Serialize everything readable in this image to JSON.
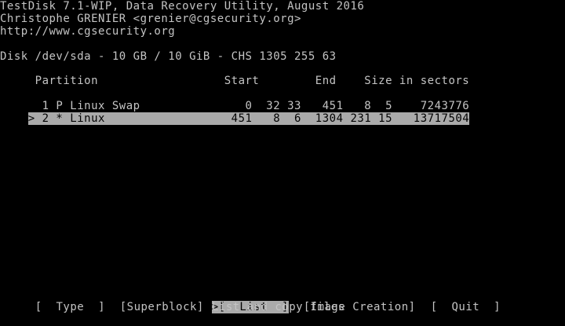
{
  "header": {
    "title": "TestDisk 7.1-WIP, Data Recovery Utility, August 2016",
    "author": "Christophe GRENIER <grenier@cgsecurity.org>",
    "url": "http://www.cgsecurity.org"
  },
  "disk": {
    "info": "Disk /dev/sda - 10 GB / 10 GiB - CHS 1305 255 63"
  },
  "table": {
    "header": "     Partition                  Start        End    Size in sectors",
    "rows": [
      {
        "text": "  1 P Linux Swap               0  32 33   451   8  5    7243776",
        "selected": false
      },
      {
        "text": "> 2 * Linux                  451   8  6  1304 231 15   13717504",
        "selected": true
      }
    ]
  },
  "menu": {
    "items": [
      {
        "label": "[  Type  ]"
      },
      {
        "label": "[Superblock]"
      },
      {
        "label": ">[  List  ]"
      },
      {
        "label": "[Image Creation]"
      },
      {
        "label": "[  Quit  ]"
      }
    ],
    "help": "List and copy files"
  },
  "colors": {
    "text": "#c4c4c4",
    "background": "#000000",
    "highlight_bg": "#aaaaaa",
    "highlight_fg": "#000000"
  }
}
